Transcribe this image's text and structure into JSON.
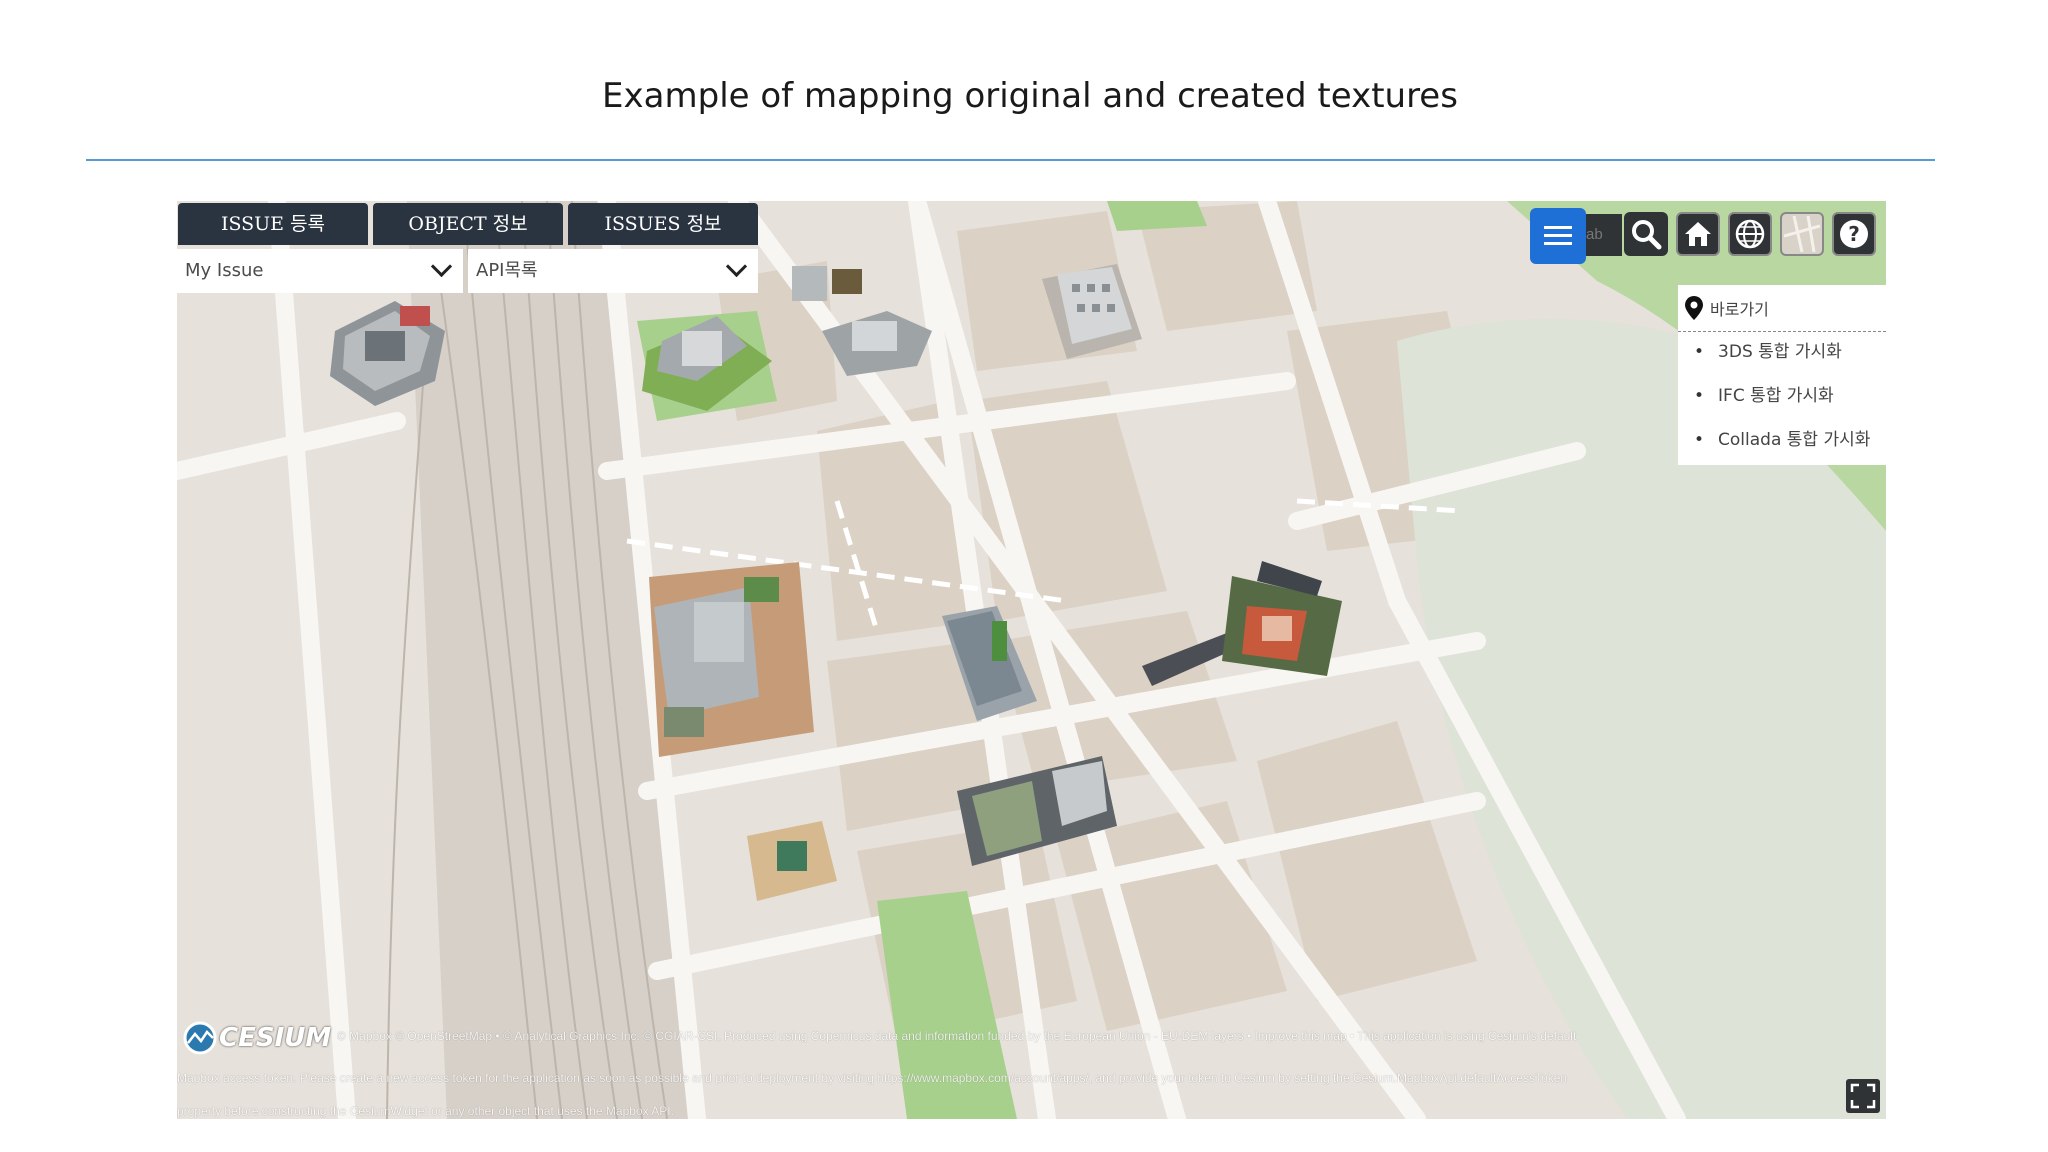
{
  "slide": {
    "title": "Example of mapping original and created textures"
  },
  "viewer": {
    "tabs": [
      {
        "label": "ISSUE 등록"
      },
      {
        "label": "OBJECT 정보"
      },
      {
        "label": "ISSUES 정보"
      }
    ],
    "selects": [
      {
        "value": "My Issue"
      },
      {
        "value": "API목록"
      }
    ],
    "toolbar": {
      "search_placeholder": "ab",
      "icons": [
        "menu-icon",
        "search-icon",
        "home-icon",
        "globe-icon",
        "map-layer-icon",
        "help-icon"
      ],
      "accent": "#1e6fd6"
    },
    "shortcut": {
      "title": "바로가기",
      "items": [
        {
          "label": "3DS 통합 가시화"
        },
        {
          "label": "IFC 통합 가시화"
        },
        {
          "label": "Collada 통합 가시화"
        }
      ]
    },
    "attribution": {
      "logo": "CESIUM",
      "line1": "© Mapbox © OpenStreetMap • © Analytical Graphics Inc. © CGIAR-CSI, Produced using Copernicus data and information funded by the European Union - EU-DEM layers • Improve this map • This application is using Cesium's default",
      "line2": "Mapbox access token. Please create a new access token for the application as soon as possible and prior to deployment by visiting https://www.mapbox.com/account/apps/, and provide your token to Cesium by setting the Cesium.MapboxApi.defaultAccessToken",
      "line3": "property before constructing the CesiumWidget or any other object that uses the Mapbox API."
    },
    "map_colors": {
      "ground": "#e6e1da",
      "road": "#f7f5f2",
      "block": "#d9cfc3",
      "park": "#a8d08d",
      "water_park": "#d6e2cf",
      "rail": "#c6bfb6"
    }
  }
}
